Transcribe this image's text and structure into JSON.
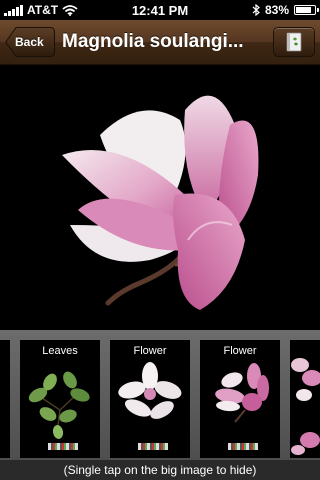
{
  "status_bar": {
    "carrier": "AT&T",
    "time": "12:41 PM",
    "battery_text": "83%",
    "battery_level": 0.83
  },
  "nav": {
    "back_label": "Back",
    "title": "Magnolia soulangi..."
  },
  "thumbnails": [
    {
      "label": ""
    },
    {
      "label": "Leaves"
    },
    {
      "label": "Flower"
    },
    {
      "label": "Flower"
    },
    {
      "label": "Fl"
    }
  ],
  "hint": "(Single tap on the big image to hide)",
  "colors": {
    "nav_brown": "#4a2f1a",
    "petal_pink": "#d77fb3",
    "petal_white": "#f3ecef",
    "strip_gray": "#5e5e5e"
  },
  "icons": {
    "book": "book-icon",
    "wifi": "wifi-icon",
    "bluetooth": "bluetooth-icon"
  }
}
